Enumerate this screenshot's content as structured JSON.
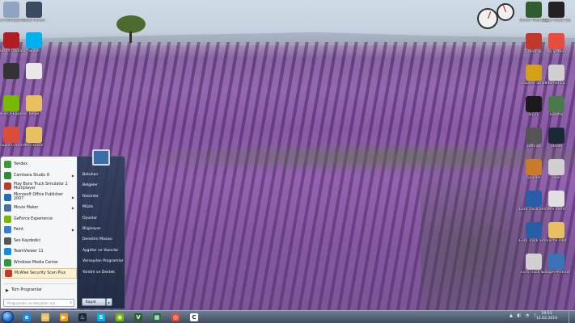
{
  "desktop": {
    "left_icons": [
      {
        "label": "Geri Dönüşüm...",
        "icon": "recycle-bin-icon",
        "color": "#8da5c0"
      },
      {
        "label": "Ubisoft Oyuncu",
        "icon": "adobe-icon",
        "color": "#b01e23"
      },
      {
        "label": "",
        "icon": "media-icon",
        "color": "#333333"
      },
      {
        "label": "GeForce Experience",
        "icon": "nvidia-icon",
        "color": "#76b900"
      },
      {
        "label": "Google Chrome",
        "icon": "chrome-icon",
        "color": "#dd4b39"
      }
    ],
    "col2_icons": [
      {
        "label": "Ocak İlavesi",
        "icon": "paint-icon",
        "color": "#3a4b60"
      },
      {
        "label": "Skype",
        "icon": "skype-icon",
        "color": "#00aff0"
      },
      {
        "label": "",
        "icon": "file-icon",
        "color": "#e8e8e8"
      },
      {
        "label": "belge",
        "icon": "folder-icon",
        "color": "#e8c060"
      },
      {
        "label": "Yeni klasör",
        "icon": "folder-icon",
        "color": "#e8c060"
      }
    ],
    "right_icons": [
      {
        "label": "Grand Theft Auto V",
        "icon": "gta-icon",
        "color": "#2f5d2f"
      },
      {
        "label": "Super Audio Gen",
        "icon": "chess-icon",
        "color": "#222222"
      },
      {
        "label": "Grand Hü",
        "icon": "star-icon",
        "color": "#c0392b"
      },
      {
        "label": "Ağ Sistemi",
        "icon": "network-icon",
        "color": "#e74c3c"
      },
      {
        "label": "Counter Strike",
        "icon": "cs-icon",
        "color": "#d4a017"
      },
      {
        "label": "Internet Ex...",
        "icon": "app-icon",
        "color": "#d0d0d0"
      },
      {
        "label": "H1Z1",
        "icon": "h1-icon",
        "color": "#1a1a1a"
      },
      {
        "label": "Assetto",
        "icon": "landscape-icon",
        "color": "#4a7a4a"
      },
      {
        "label": "Settings",
        "icon": "gear-icon",
        "color": "#555555"
      },
      {
        "label": "Steam",
        "icon": "steam-icon",
        "color": "#1b2838"
      },
      {
        "label": "Oyunlar",
        "icon": "game-icon",
        "color": "#c97b2a"
      },
      {
        "label": "User",
        "icon": "user-icon",
        "color": "#d0d0d0"
      },
      {
        "label": "Euro Truck Simulator 2",
        "icon": "truck-icon",
        "color": "#2a5da8"
      },
      {
        "label": "Yeni metin",
        "icon": "document-icon",
        "color": "#e0e0e0"
      },
      {
        "label": "Euro Truck Simulator",
        "icon": "truck-icon",
        "color": "#2a5da8"
      },
      {
        "label": "Cache Pilot",
        "icon": "archive-icon",
        "color": "#e8c060"
      },
      {
        "label": "Euro Truck S...",
        "icon": "truck-icon",
        "color": "#d0d0d0"
      },
      {
        "label": "Google Android Mod 5 Yaz...",
        "icon": "g-icon",
        "color": "#3b73b9"
      }
    ]
  },
  "gadget": {
    "name": "cpu-meter"
  },
  "start_menu": {
    "programs": [
      {
        "label": "Yandex",
        "icon": "yandex-icon",
        "color": "#3a9a3a",
        "arrow": false
      },
      {
        "label": "Camtasia Studio 8",
        "icon": "camtasia-icon",
        "color": "#2f8a3a",
        "arrow": true
      },
      {
        "label": "Play Bons Truck Simulator 2 Multiplayer",
        "icon": "truck-icon",
        "color": "#c0392b",
        "arrow": false
      },
      {
        "label": "Microsoft Office Publisher 2007",
        "icon": "publisher-icon",
        "color": "#1e6fb8",
        "arrow": true
      },
      {
        "label": "Movie Maker",
        "icon": "movie-icon",
        "color": "#4a6fa5",
        "arrow": true
      },
      {
        "label": "GeForce Experience",
        "icon": "nvidia-icon",
        "color": "#76b900",
        "arrow": false
      },
      {
        "label": "Paint",
        "icon": "paint-icon",
        "color": "#3a7bd5",
        "arrow": true
      },
      {
        "label": "Ses Kaydedici",
        "icon": "mic-icon",
        "color": "#555555",
        "arrow": false
      },
      {
        "label": "TeamViewer 11",
        "icon": "teamviewer-icon",
        "color": "#0e8ee9",
        "arrow": false
      },
      {
        "label": "Windows Media Center",
        "icon": "media-center-icon",
        "color": "#2d9a3a",
        "arrow": false
      },
      {
        "label": "McAfee Security Scan Plus",
        "icon": "mcafee-icon",
        "color": "#c0392b",
        "arrow": false
      }
    ],
    "all_programs": "Tüm Programlar",
    "search_placeholder": "Programları ve dosyaları ara",
    "right_items": [
      "Batuhan",
      "Belgeler",
      "Resimler",
      "Müzik",
      "Oyunlar",
      "Bilgisayar",
      "Denetim Masası",
      "Aygıtlar ve Yazıcılar",
      "Varsayılan Programlar",
      "Yardım ve Destek"
    ],
    "shutdown": "Kapat"
  },
  "taskbar": {
    "pinned": [
      {
        "name": "ie-icon",
        "color": "#1e88e5",
        "glyph": "e"
      },
      {
        "name": "explorer-icon",
        "color": "#e8c060",
        "glyph": "▭"
      },
      {
        "name": "media-player-icon",
        "color": "#f39c12",
        "glyph": "▶"
      },
      {
        "name": "steam-icon",
        "color": "#1b2838",
        "glyph": "♨"
      },
      {
        "name": "skype-icon",
        "color": "#00aff0",
        "glyph": "S"
      },
      {
        "name": "nvidia-icon",
        "color": "#76b900",
        "glyph": "◉"
      },
      {
        "name": "gta-icon",
        "color": "#2f5d2f",
        "glyph": "V"
      },
      {
        "name": "spreadsheet-icon",
        "color": "#1e7145",
        "glyph": "▦"
      },
      {
        "name": "chrome-icon",
        "color": "#dd4b39",
        "glyph": "◎"
      },
      {
        "name": "camtasia-icon",
        "color": "#ffffff",
        "glyph": "C"
      }
    ],
    "tray_icons": "▲ ◧ ◔ ♪",
    "time": "19:53",
    "date": "12.02.2016"
  }
}
